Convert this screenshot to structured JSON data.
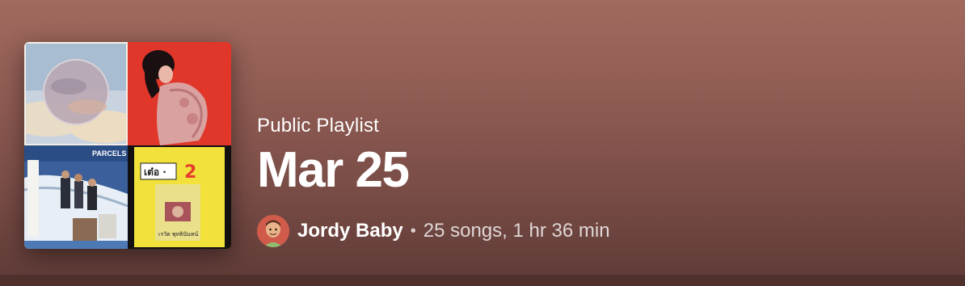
{
  "playlist": {
    "type_label": "Public Playlist",
    "title": "Mar 25",
    "owner": "Jordy Baby",
    "separator": "•",
    "stats": "25 songs, 1 hr 36 min"
  },
  "cover_art": {
    "tiles": [
      {
        "name": "album-art-cloudy-sky",
        "accent": "#c9d6e3"
      },
      {
        "name": "album-art-red-portrait",
        "accent": "#e0372a"
      },
      {
        "name": "album-art-parcels",
        "accent": "#2b4d86",
        "text": "PARCELS"
      },
      {
        "name": "album-art-yellow-thai",
        "accent": "#f1e13a",
        "text": "เต๋อ 2",
        "subtext": "เรวัต พุทธินันทน์"
      }
    ]
  },
  "colors": {
    "background_top": "#a16a5f",
    "background_bottom": "#5e3a36",
    "text_primary": "#ffffff",
    "avatar_bg": "#d05b4a"
  }
}
